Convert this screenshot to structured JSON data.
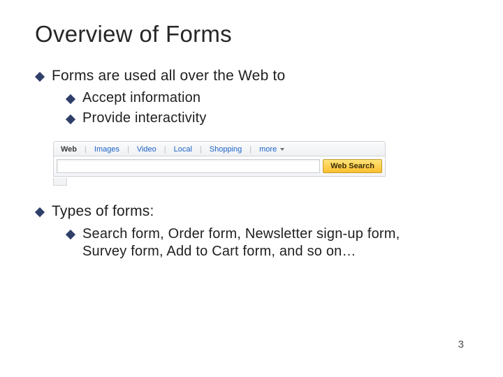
{
  "title": "Overview of Forms",
  "bullets": {
    "b1": "Forms are used all over the Web to",
    "b1_children": {
      "c1": "Accept information",
      "c2": "Provide interactivity"
    },
    "b2": "Types of forms:",
    "b2_children": {
      "c1": "Search form, Order form, Newsletter sign-up form, Survey form,  Add to Cart form, and so on…"
    }
  },
  "searchbar": {
    "tabs": {
      "web": "Web",
      "images": "Images",
      "video": "Video",
      "local": "Local",
      "shopping": "Shopping",
      "more": "more"
    },
    "button": "Web Search"
  },
  "page_number": "3"
}
